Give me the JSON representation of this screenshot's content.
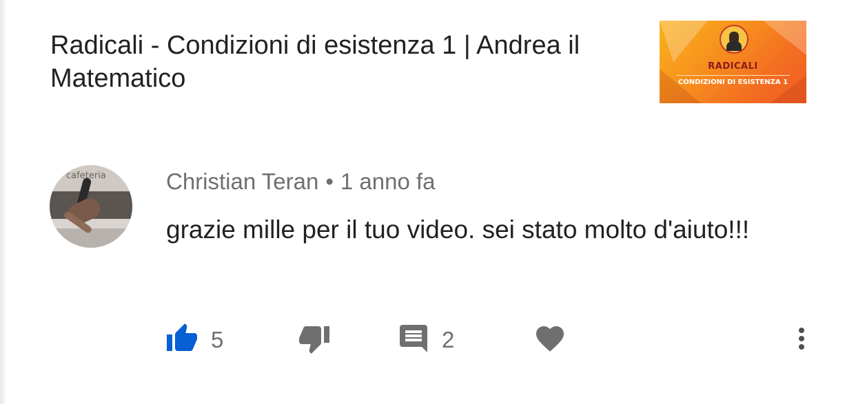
{
  "video": {
    "title": "Radicali - Condizioni di esistenza 1 | Andrea il Matematico",
    "thumbnail": {
      "title": "RADICALI",
      "subtitle": "CONDIZIONI DI ESISTENZA 1"
    }
  },
  "comment": {
    "author": "Christian Teran",
    "separator": "•",
    "time": "1 anno fa",
    "text": "grazie mille per il tuo video. sei stato molto d'aiuto!!!",
    "avatar_sign": "cafeteria"
  },
  "actions": {
    "likes": "5",
    "replies": "2",
    "like_icon": "thumb-up-icon",
    "dislike_icon": "thumb-down-icon",
    "reply_icon": "comment-icon",
    "heart_icon": "heart-icon",
    "more_icon": "more-vert-icon"
  },
  "colors": {
    "like_active": "#065fd4",
    "icon_gray": "#6f6f6f",
    "text": "#212121",
    "thumb_orange": "#f7941d"
  }
}
